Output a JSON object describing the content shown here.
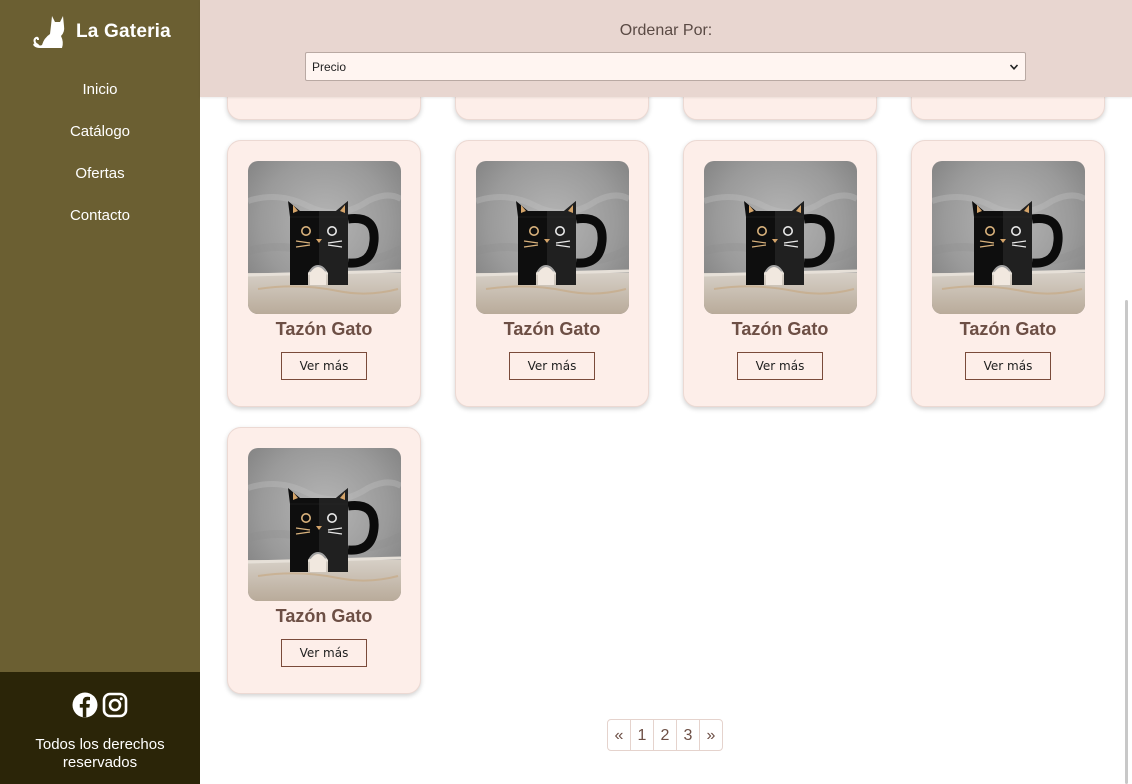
{
  "brand": {
    "name": "La Gateria",
    "icon": "cat-silhouette-icon"
  },
  "nav": [
    {
      "label": "Inicio"
    },
    {
      "label": "Catálogo"
    },
    {
      "label": "Ofertas"
    },
    {
      "label": "Contacto"
    }
  ],
  "footer": {
    "rights": "Todos los derechos reservados",
    "social": [
      "facebook-icon",
      "instagram-icon"
    ]
  },
  "sort": {
    "label": "Ordenar Por:",
    "selected": "Precio"
  },
  "products": [
    {
      "title": "Tazón Gato",
      "button": "Ver más"
    },
    {
      "title": "Tazón Gato",
      "button": "Ver más"
    },
    {
      "title": "Tazón Gato",
      "button": "Ver más"
    },
    {
      "title": "Tazón Gato",
      "button": "Ver más"
    },
    {
      "title": "Tazón Gato",
      "button": "Ver más"
    }
  ],
  "pagination": {
    "prev": "«",
    "pages": [
      "1",
      "2",
      "3"
    ],
    "next": "»"
  },
  "colors": {
    "sidebar": "#6b5f32",
    "sidebar_footer": "#2b2508",
    "sortbar": "#e8d6d0",
    "card": "#fdeee9",
    "accent_text": "#6d4f45"
  }
}
